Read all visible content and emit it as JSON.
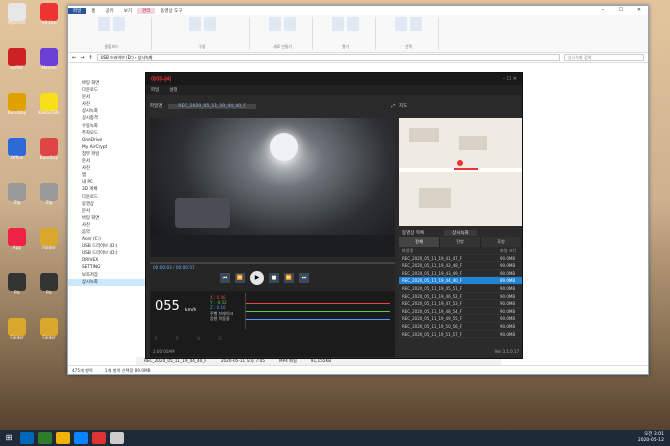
{
  "desktop_icons": [
    {
      "label": "MyDrive",
      "color": "#e7e7e7"
    },
    {
      "label": "V3 Lite",
      "color": "#e33"
    },
    {
      "label": "ezPDF",
      "color": "#c22"
    },
    {
      "label": "Movavi",
      "color": "#6a3fd3"
    },
    {
      "label": "Bandizip",
      "color": "#e0a000"
    },
    {
      "label": "KakaoTalk",
      "color": "#f7e017"
    },
    {
      "label": "Office",
      "color": "#2c6ad8"
    },
    {
      "label": "Bandizip",
      "color": "#d44"
    },
    {
      "label": "Zip",
      "color": "#999"
    },
    {
      "label": "Zip",
      "color": "#999"
    },
    {
      "label": "App",
      "color": "#e24"
    },
    {
      "label": "Folder",
      "color": "#d9a72c"
    },
    {
      "label": "Pic",
      "color": "#333"
    },
    {
      "label": "Pic",
      "color": "#333"
    },
    {
      "label": "Folder",
      "color": "#d9a72c"
    },
    {
      "label": "Folder",
      "color": "#d9a72c"
    }
  ],
  "explorer": {
    "tabs": [
      "파일",
      "홈",
      "공유",
      "보기",
      "관리",
      "동영상 도구"
    ],
    "ribbon_groups": [
      "클립보드",
      "구성",
      "새로 만들기",
      "열기",
      "선택"
    ],
    "address": "USB 드라이브 (D:) › 상시녹화",
    "search_placeholder": "상시녹화 검색",
    "side_items": [
      "바탕 화면",
      "다운로드",
      "문서",
      "사진",
      "상시녹화",
      "상시충격",
      "수동녹화",
      "주차모드",
      "OneDrive",
      "My AirCrypt",
      "첨부 파일",
      "문서",
      "사진",
      "앱",
      "내 PC",
      "3D 개체",
      "다운로드",
      "동영상",
      "문서",
      "바탕 화면",
      "사진",
      "음악",
      "Acer (C:)",
      "USB 드라이브 (D:)",
      "USB 드라이브 (D:)",
      "DRIVEX",
      "SETTING",
      "보조저장",
      "상시녹화"
    ],
    "status_count": "475개 항목",
    "status_selected": "1개 항목 선택함 89.0MB",
    "file_row": {
      "name": "REC_2020_05_11_19_44_40_F",
      "date": "2020-05-11 오후 7:45",
      "type": "MP4 파일",
      "size": "91,155KB"
    }
  },
  "player": {
    "brand": "아이나비",
    "menu": [
      "파일",
      "설정"
    ],
    "tab_file": "파일명",
    "current_file": "REC_2020_05_11_19_44_40_F",
    "map_label": "지도",
    "time_current": "00:00:03",
    "time_total": "00:00:57",
    "speed": "055",
    "speed_unit": "km/h",
    "gsensor": [
      "X : 0.46",
      "Y : -0.52",
      "Z : 0.16"
    ],
    "status_lines": [
      "주행 브레이크",
      "음향 작동중"
    ],
    "timestamp": "2:00:00AM",
    "gears": [
      "P",
      "R",
      "N",
      "D"
    ],
    "list_title": "동영상 목록",
    "list_dir": "상시녹화",
    "list_tabs": [
      "전체",
      "전방",
      "후방"
    ],
    "list_headers": [
      "파일명",
      "파일 크기"
    ],
    "files": [
      [
        "REC_2020_05_11_19_41_47_F",
        "90.0MB"
      ],
      [
        "REC_2020_05_11_19_42_48_F",
        "90.0MB"
      ],
      [
        "REC_2020_05_11_19_43_49_F",
        "90.0MB"
      ],
      [
        "REC_2020_05_11_19_44_40_F",
        "89.0MB"
      ],
      [
        "REC_2020_05_11_19_45_51_F",
        "90.0MB"
      ],
      [
        "REC_2020_05_11_19_46_52_F",
        "90.0MB"
      ],
      [
        "REC_2020_05_11_19_47_53_F",
        "90.0MB"
      ],
      [
        "REC_2020_05_11_19_48_54_F",
        "90.0MB"
      ],
      [
        "REC_2020_05_11_19_49_55_F",
        "90.0MB"
      ],
      [
        "REC_2020_05_11_19_50_56_F",
        "90.0MB"
      ],
      [
        "REC_2020_05_11_19_51_57_F",
        "90.0MB"
      ]
    ],
    "selected_index": 3,
    "version": "Ver 3.1.0.17"
  },
  "taskbar": {
    "time": "오전 3:01",
    "date": "2020-05-12",
    "lang": "A",
    "colors": [
      "#0067b8",
      "#2d7d2d",
      "#f1b10b",
      "#0a84ff",
      "#d33",
      "#ccc"
    ]
  }
}
